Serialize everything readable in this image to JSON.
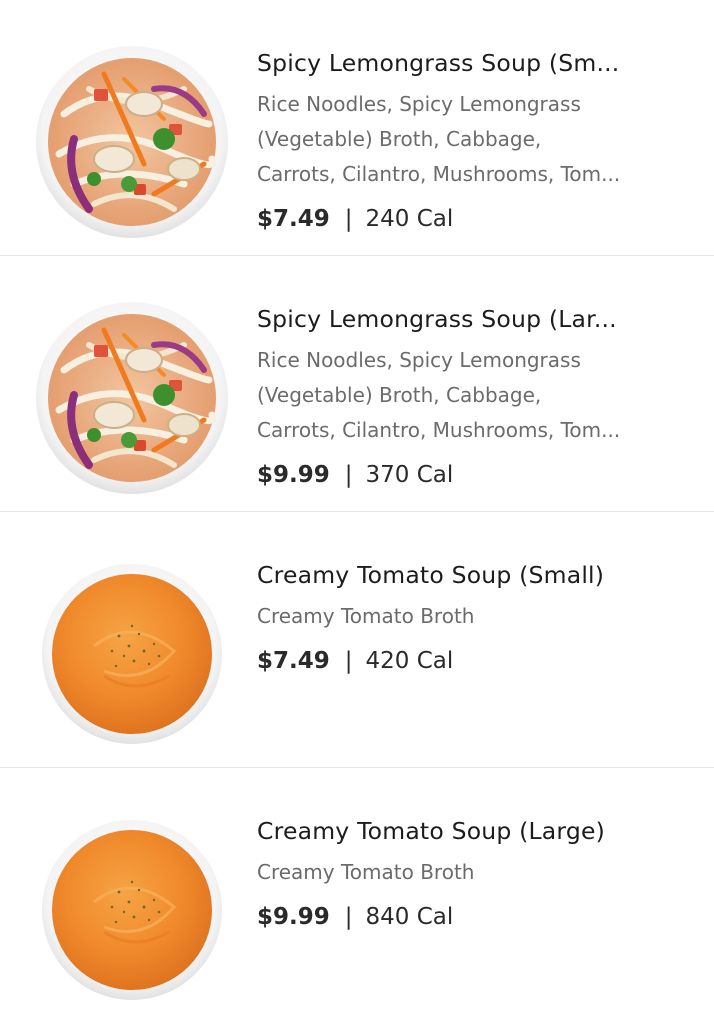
{
  "menu": {
    "items": [
      {
        "image": "lemongrass-noodle-soup-bowl",
        "title": "Spicy Lemongrass Soup (Sm...",
        "desc_lines": [
          "Rice Noodles, Spicy Lemongrass",
          "(Vegetable) Broth, Cabbage,",
          "Carrots, Cilantro, Mushrooms, Tom..."
        ],
        "price": "$7.49",
        "separator": "|",
        "calories": "240 Cal"
      },
      {
        "image": "lemongrass-noodle-soup-bowl",
        "title": "Spicy Lemongrass Soup (Lar...",
        "desc_lines": [
          "Rice Noodles, Spicy Lemongrass",
          "(Vegetable) Broth, Cabbage,",
          "Carrots, Cilantro, Mushrooms, Tom..."
        ],
        "price": "$9.99",
        "separator": "|",
        "calories": "370 Cal"
      },
      {
        "image": "creamy-tomato-soup-bowl",
        "title": "Creamy Tomato Soup (Small)",
        "desc_lines": [
          "Creamy Tomato Broth"
        ],
        "price": "$7.49",
        "separator": "|",
        "calories": "420 Cal"
      },
      {
        "image": "creamy-tomato-soup-bowl",
        "title": "Creamy Tomato Soup (Large)",
        "desc_lines": [
          "Creamy Tomato Broth"
        ],
        "price": "$9.99",
        "separator": "|",
        "calories": "840 Cal"
      }
    ]
  },
  "colors": {
    "title": "#1c1c1c",
    "description": "#6b6b6b",
    "divider": "#e6e6e6",
    "tomato_soup": "#f08a2c",
    "broth": "#e8a87a"
  }
}
